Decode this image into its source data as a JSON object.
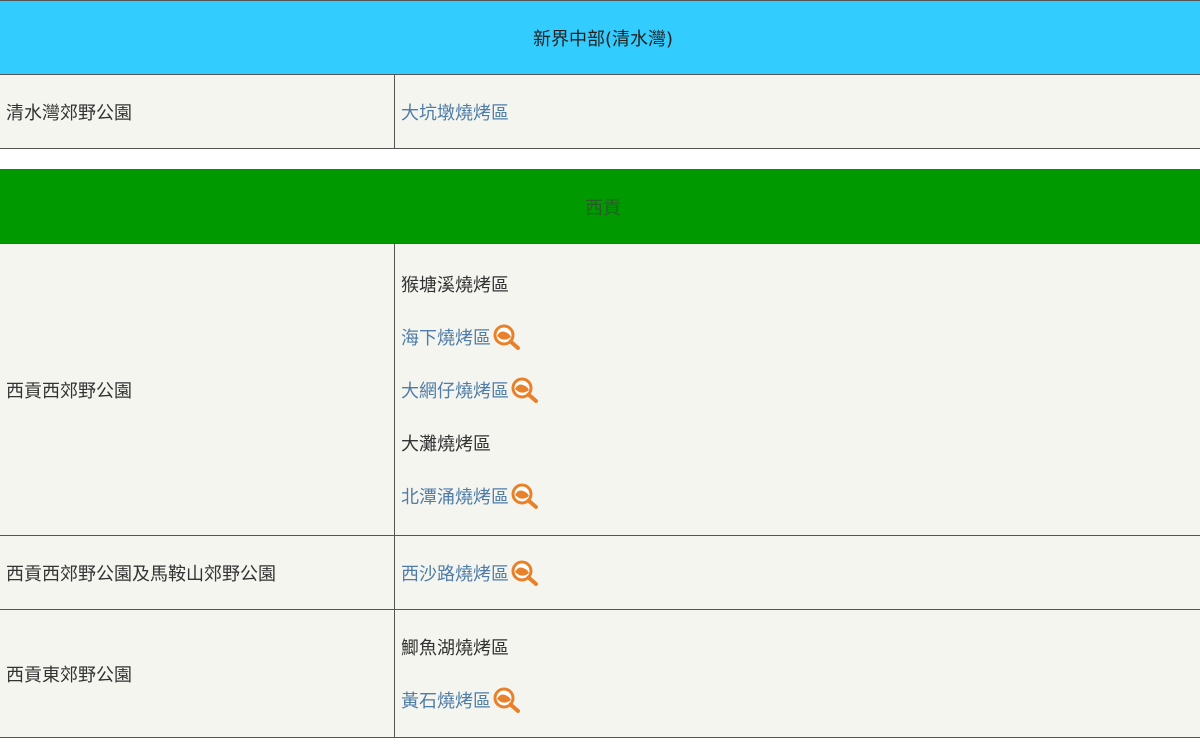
{
  "region_central": {
    "title": "新界中部(清水灣)",
    "rows": [
      {
        "park": "清水灣郊野公園",
        "sites": [
          {
            "name": "大坑墩燒烤區",
            "link": true,
            "icon": false
          }
        ]
      }
    ]
  },
  "region_saikung": {
    "title": "西貢",
    "rows": [
      {
        "park": "西貢西郊野公園",
        "sites": [
          {
            "name": "猴塘溪燒烤區",
            "link": false,
            "icon": false
          },
          {
            "name": "海下燒烤區",
            "link": true,
            "icon": true
          },
          {
            "name": "大網仔燒烤區",
            "link": true,
            "icon": true
          },
          {
            "name": "大灘燒烤區",
            "link": false,
            "icon": false
          },
          {
            "name": "北潭涌燒烤區",
            "link": true,
            "icon": true
          }
        ]
      },
      {
        "park": "西貢西郊野公園及馬鞍山郊野公園",
        "sites": [
          {
            "name": "西沙路燒烤區",
            "link": true,
            "icon": true
          }
        ]
      },
      {
        "park": "西貢東郊野公園",
        "sites": [
          {
            "name": "鯽魚湖燒烤區",
            "link": false,
            "icon": false
          },
          {
            "name": "黃石燒烤區",
            "link": true,
            "icon": true
          }
        ]
      }
    ]
  },
  "icons": {
    "magnifier": "magnifier-map-icon"
  },
  "colors": {
    "header_blue": "#33ccff",
    "header_green": "#009900",
    "link": "#4f7ca8",
    "icon_orange": "#e8812a"
  }
}
